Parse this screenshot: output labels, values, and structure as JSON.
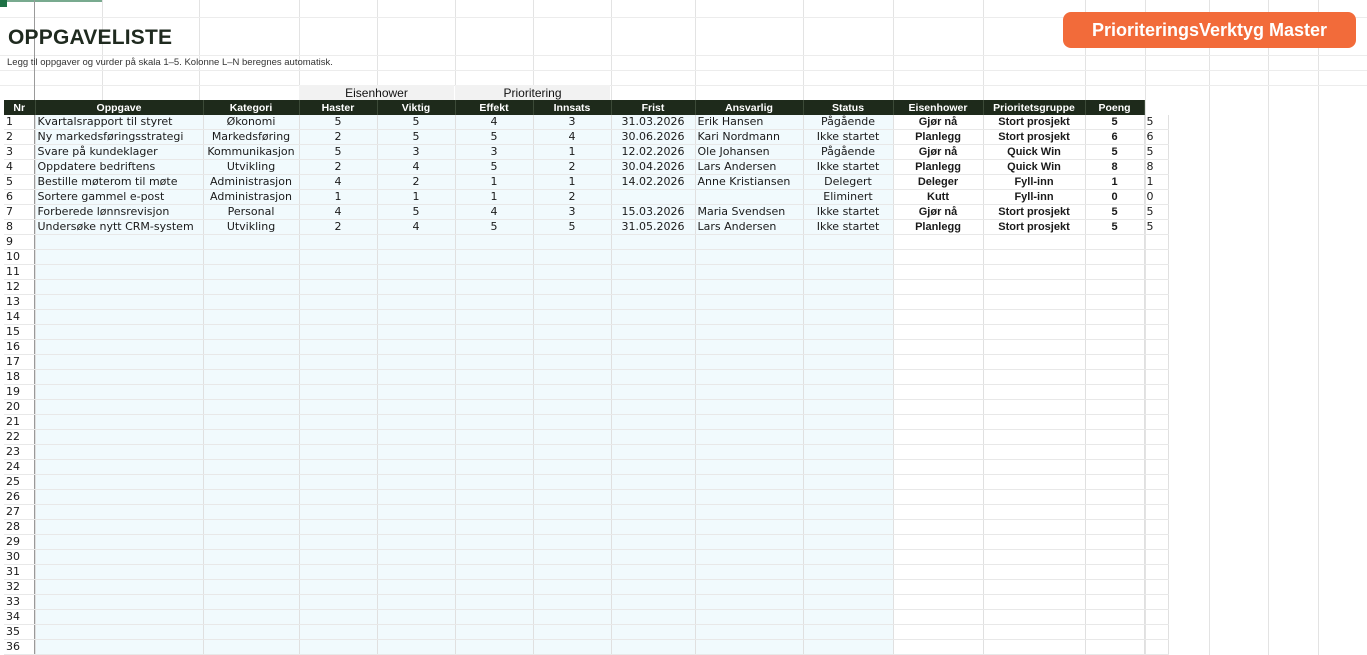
{
  "sheet": {
    "title": "OPPGAVELISTE",
    "subtitle": "Legg til oppgaver og vurder på skala 1–5. Kolonne L–N beregnes automatisk.",
    "master_button_label": "PrioriteringsVerktyg Master"
  },
  "header_groups": {
    "eisenhower": "Eisenhower",
    "prioritering": "Prioritering"
  },
  "columns": [
    "Nr",
    "Oppgave",
    "Kategori",
    "Haster",
    "Viktig",
    "Effekt",
    "Innsats",
    "Frist",
    "Ansvarlig",
    "Status",
    "Eisenhower",
    "Prioritetsgruppe",
    "Poeng"
  ],
  "rows": [
    {
      "nr": "1",
      "oppgave": "Kvartalsrapport til styret",
      "kategori": "Økonomi",
      "haster": "5",
      "viktig": "5",
      "effekt": "4",
      "innsats": "3",
      "frist": "31.03.2026",
      "ansvarlig": "Erik Hansen",
      "status": "Pågående",
      "eisenhower": "Gjør nå",
      "gruppe": "Stort prosjekt",
      "poeng": "5",
      "extra": "5"
    },
    {
      "nr": "2",
      "oppgave": "Ny markedsføringsstrategi",
      "kategori": "Markedsføring",
      "haster": "2",
      "viktig": "5",
      "effekt": "5",
      "innsats": "4",
      "frist": "30.06.2026",
      "ansvarlig": "Kari Nordmann",
      "status": "Ikke startet",
      "eisenhower": "Planlegg",
      "gruppe": "Stort prosjekt",
      "poeng": "6",
      "extra": "6"
    },
    {
      "nr": "3",
      "oppgave": "Svare på kundeklager",
      "kategori": "Kommunikasjon",
      "haster": "5",
      "viktig": "3",
      "effekt": "3",
      "innsats": "1",
      "frist": "12.02.2026",
      "ansvarlig": "Ole Johansen",
      "status": "Pågående",
      "eisenhower": "Gjør nå",
      "gruppe": "Quick Win",
      "poeng": "5",
      "extra": "5"
    },
    {
      "nr": "4",
      "oppgave": "Oppdatere bedriftens",
      "kategori": "Utvikling",
      "haster": "2",
      "viktig": "4",
      "effekt": "5",
      "innsats": "2",
      "frist": "30.04.2026",
      "ansvarlig": "Lars Andersen",
      "status": "Ikke startet",
      "eisenhower": "Planlegg",
      "gruppe": "Quick Win",
      "poeng": "8",
      "extra": "8"
    },
    {
      "nr": "5",
      "oppgave": "Bestille møterom til møte",
      "kategori": "Administrasjon",
      "haster": "4",
      "viktig": "2",
      "effekt": "1",
      "innsats": "1",
      "frist": "14.02.2026",
      "ansvarlig": "Anne Kristiansen",
      "status": "Delegert",
      "eisenhower": "Deleger",
      "gruppe": "Fyll-inn",
      "poeng": "1",
      "extra": "1"
    },
    {
      "nr": "6",
      "oppgave": "Sortere gammel e-post",
      "kategori": "Administrasjon",
      "haster": "1",
      "viktig": "1",
      "effekt": "1",
      "innsats": "2",
      "frist": "",
      "ansvarlig": "",
      "status": "Eliminert",
      "eisenhower": "Kutt",
      "gruppe": "Fyll-inn",
      "poeng": "0",
      "extra": "0"
    },
    {
      "nr": "7",
      "oppgave": "Forberede lønnsrevisjon",
      "kategori": "Personal",
      "haster": "4",
      "viktig": "5",
      "effekt": "4",
      "innsats": "3",
      "frist": "15.03.2026",
      "ansvarlig": "Maria Svendsen",
      "status": "Ikke startet",
      "eisenhower": "Gjør nå",
      "gruppe": "Stort prosjekt",
      "poeng": "5",
      "extra": "5"
    },
    {
      "nr": "8",
      "oppgave": "Undersøke nytt CRM-system",
      "kategori": "Utvikling",
      "haster": "2",
      "viktig": "4",
      "effekt": "5",
      "innsats": "5",
      "frist": "31.05.2026",
      "ansvarlig": "Lars Andersen",
      "status": "Ikke startet",
      "eisenhower": "Planlegg",
      "gruppe": "Stort prosjekt",
      "poeng": "5",
      "extra": "5"
    }
  ],
  "empty_row_numbers": [
    "9",
    "10",
    "11",
    "12",
    "13",
    "14",
    "15",
    "16",
    "17",
    "18",
    "19",
    "20",
    "21",
    "22",
    "23",
    "24",
    "25",
    "26",
    "27",
    "28",
    "29",
    "30",
    "31",
    "32",
    "33",
    "34",
    "35",
    "36"
  ]
}
